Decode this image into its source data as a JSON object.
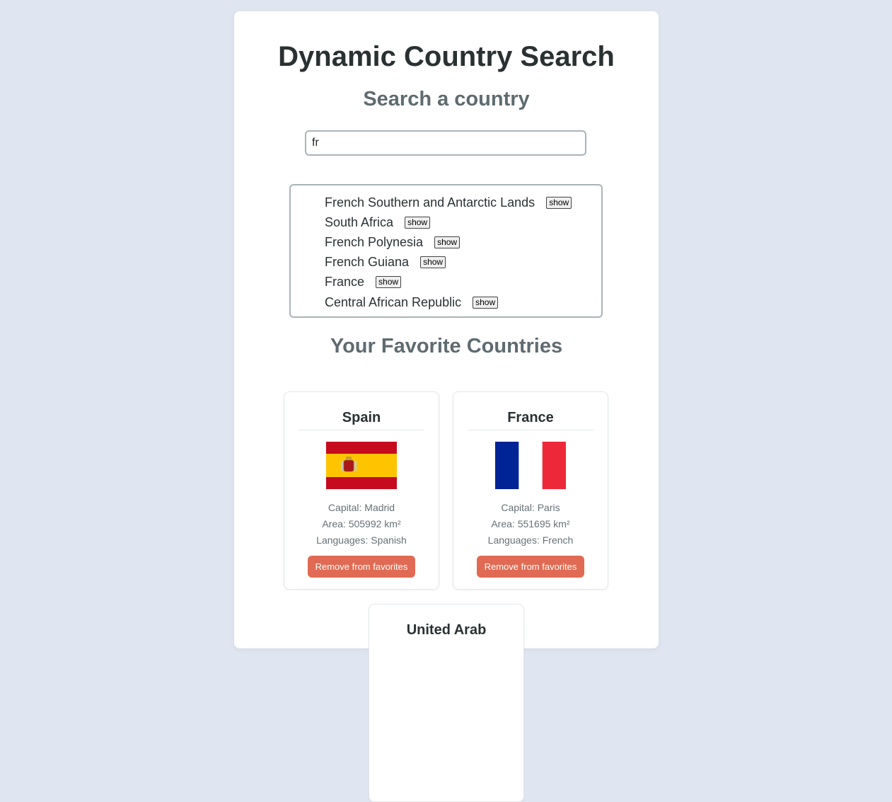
{
  "page_title": "Dynamic Country Search",
  "search_section": {
    "heading": "Search a country",
    "input_value": "fr"
  },
  "results": [
    {
      "name": "French Southern and Antarctic Lands",
      "button_label": "show"
    },
    {
      "name": "South Africa",
      "button_label": "show"
    },
    {
      "name": "French Polynesia",
      "button_label": "show"
    },
    {
      "name": "French Guiana",
      "button_label": "show"
    },
    {
      "name": "France",
      "button_label": "show"
    },
    {
      "name": "Central African Republic",
      "button_label": "show"
    }
  ],
  "favorites_section": {
    "heading": "Your Favorite Countries",
    "cards": [
      {
        "name": "Spain",
        "capital": "Capital: Madrid",
        "area": "Area: 505992 km²",
        "languages": "Languages: Spanish",
        "button_label": "Remove from favorites",
        "flag": "spain-flag"
      },
      {
        "name": "France",
        "capital": "Capital: Paris",
        "area": "Area: 551695 km²",
        "languages": "Languages: French",
        "button_label": "Remove from favorites",
        "flag": "france-flag"
      },
      {
        "name": "United Arab"
      }
    ]
  },
  "colors": {
    "background": "#e0e6f1",
    "remove_button": "#e06a53",
    "spain_red": "#c60b1e",
    "spain_yellow": "#ffc400",
    "france_blue": "#002395",
    "france_red": "#ed2939"
  }
}
